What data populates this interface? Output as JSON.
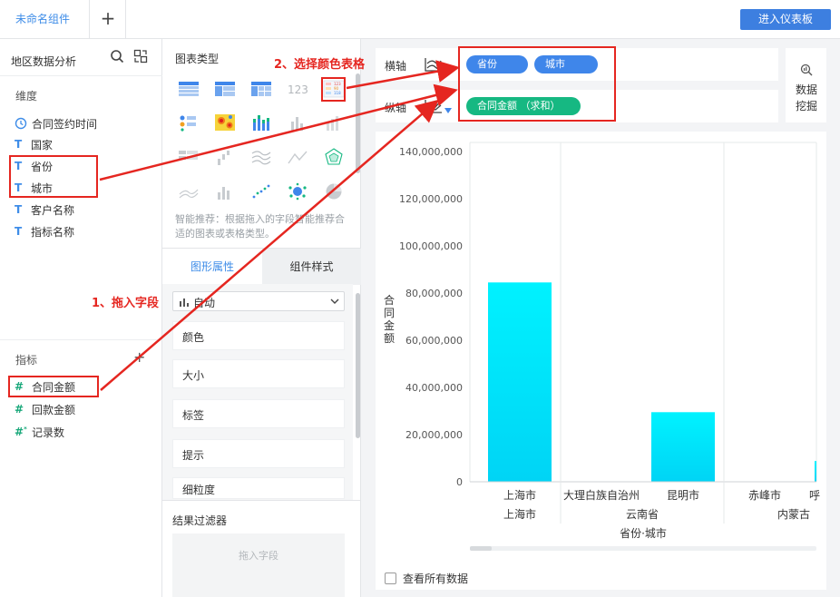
{
  "topbar": {
    "tab": "未命名组件",
    "add": "+",
    "enter_dashboard": "进入仪表板"
  },
  "left": {
    "dataset_title": "地区数据分析",
    "dimension_label": "维度",
    "dimensions": [
      "合同签约时间",
      "国家",
      "省份",
      "城市",
      "客户名称",
      "指标名称"
    ],
    "metric_label": "指标",
    "metric_add": "+",
    "metrics": [
      "合同金额",
      "回款金额",
      "记录数"
    ]
  },
  "types_panel": {
    "title": "图表类型",
    "hint": "智能推荐：根据拖入的字段智能推荐合适的图表或表格类型。",
    "tab_shape": "图形属性",
    "tab_style": "组件样式",
    "select_value": "自动",
    "props": [
      "颜色",
      "大小",
      "标签",
      "提示",
      "细粒度"
    ],
    "filter_title": "结果过滤器",
    "filter_placeholder": "拖入字段"
  },
  "axes": {
    "x_label": "横轴",
    "y_label": "纵轴",
    "x_pills": [
      "省份",
      "城市"
    ],
    "y_pills": [
      "合同金额 （求和）"
    ],
    "mining_line1": "数据",
    "mining_line2": "挖掘"
  },
  "annotations": {
    "step1": "1、拖入字段",
    "step2": "2、选择颜色表格"
  },
  "chart_data": {
    "type": "bar",
    "ylabel": "合同金额",
    "xlabel": "省份·城市",
    "ylim": [
      0,
      140000000
    ],
    "yticks": [
      "0",
      "20,000,000",
      "40,000,000",
      "60,000,000",
      "80,000,000",
      "100,000,000",
      "120,000,000",
      "140,000,000"
    ],
    "categories": [
      {
        "province": "上海市",
        "city": "上海市",
        "value": 84500000
      },
      {
        "province": "云南省",
        "city": "大理白族自治州",
        "value": 0
      },
      {
        "province": "云南省",
        "city": "昆明市",
        "value": 29500000
      },
      {
        "province": "内蒙古",
        "city": "赤峰市",
        "value": 0
      },
      {
        "province": "内蒙古",
        "city": "呼",
        "value": 8800000
      }
    ],
    "groups": [
      "上海市",
      "云南省",
      "内蒙古"
    ],
    "bar_color_top": "#00f2ff",
    "bar_color_bottom": "#00d4f5",
    "show_all_label": "查看所有数据"
  }
}
